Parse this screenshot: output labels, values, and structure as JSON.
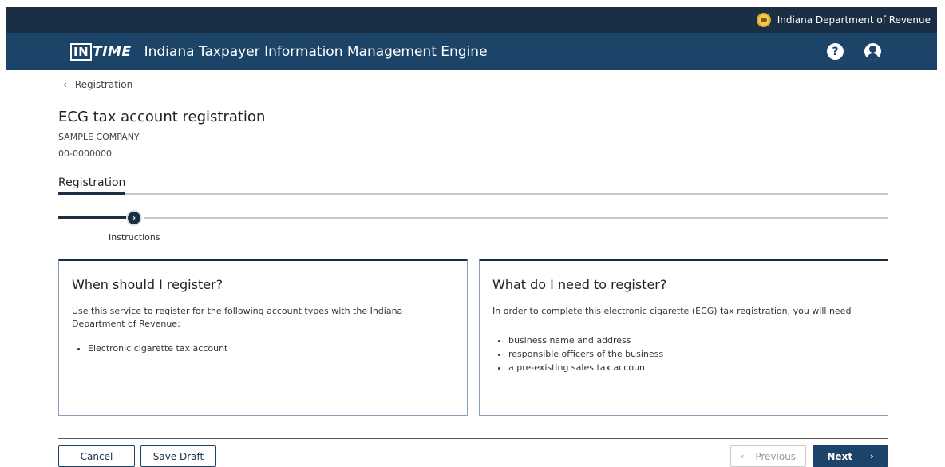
{
  "header": {
    "agency": "Indiana Department of Revenue",
    "logo_in": "IN",
    "logo_time": "TIME",
    "app_title": "Indiana Taxpayer Information Management Engine",
    "help_glyph": "?"
  },
  "breadcrumb": {
    "chevron": "‹",
    "label": "Registration"
  },
  "page": {
    "title": "ECG tax account registration",
    "company": "SAMPLE COMPANY",
    "account_id": "00-0000000"
  },
  "tabs": [
    {
      "label": "Registration",
      "active": true
    }
  ],
  "steps": [
    {
      "label": "Instructions",
      "glyph": "›",
      "active": true
    }
  ],
  "cards": {
    "left": {
      "heading": "When should I register?",
      "text": "Use this service to register for the following account types with the Indiana Department of Revenue:",
      "items": [
        "Electronic cigarette tax account"
      ]
    },
    "right": {
      "heading": "What do I need to register?",
      "text": "In order to complete this electronic cigarette (ECG) tax registration, you will need",
      "items": [
        "business name and address",
        "responsible officers of the business",
        "a pre-existing sales tax account"
      ]
    }
  },
  "footer": {
    "cancel": "Cancel",
    "save_draft": "Save Draft",
    "previous": "Previous",
    "previous_arrow": "‹",
    "next": "Next",
    "next_arrow": "›"
  },
  "colors": {
    "topbar": "#1a2e44",
    "mainbar": "#1c4469",
    "accent": "#1a2e44"
  }
}
